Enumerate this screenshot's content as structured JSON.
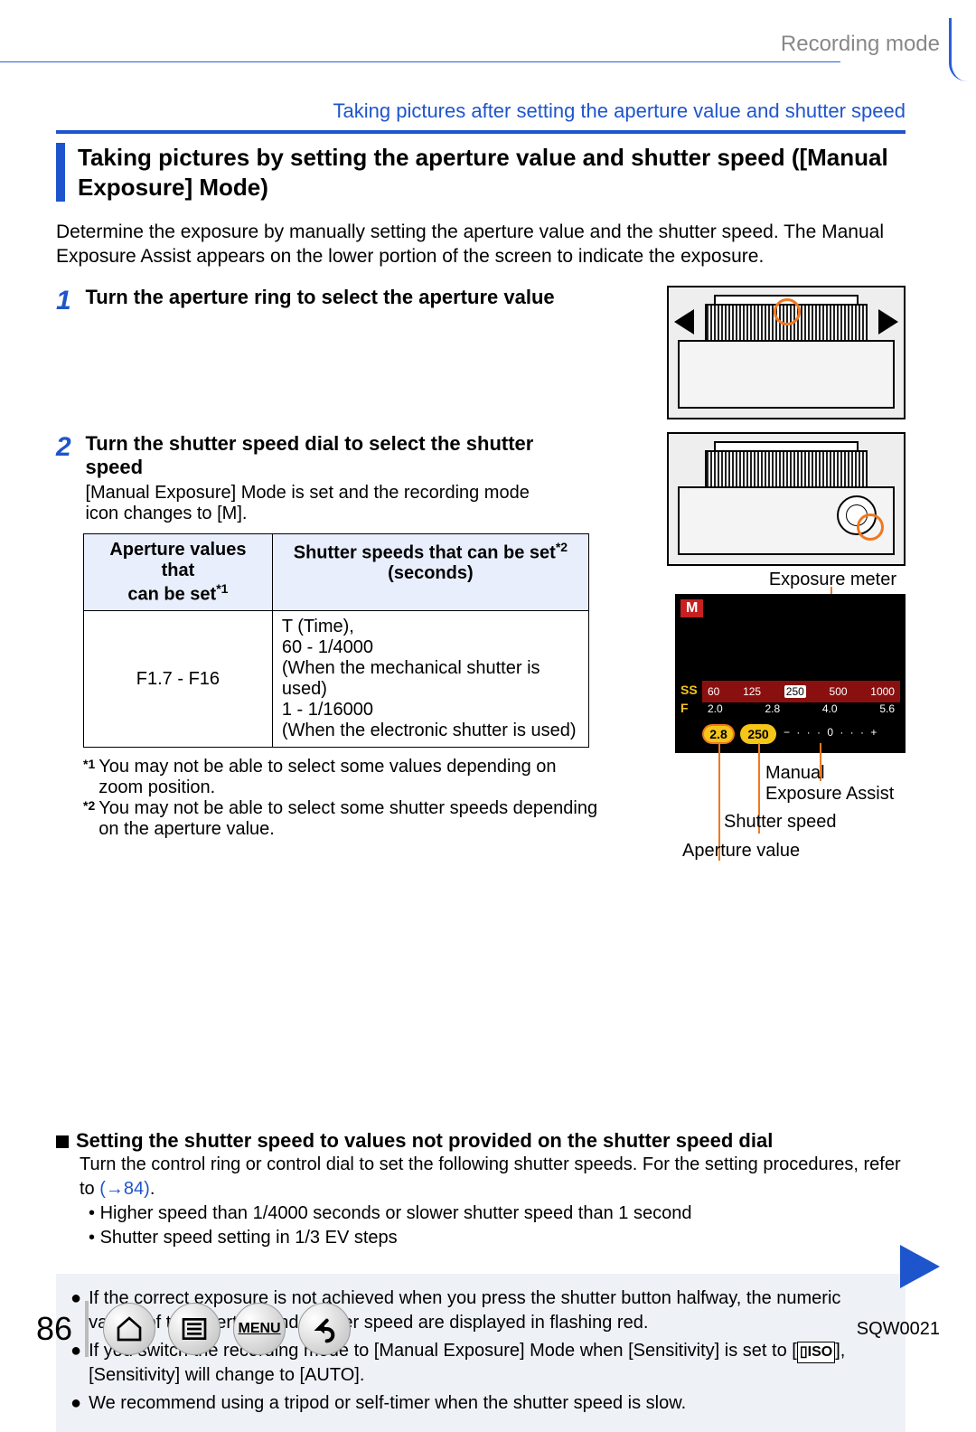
{
  "header": {
    "mode_label": "Recording mode",
    "breadcrumb": "Taking pictures after setting the aperture value and shutter speed"
  },
  "title": "Taking pictures by setting the aperture value and shutter speed ([Manual Exposure] Mode)",
  "intro": "Determine the exposure by manually setting the aperture value and the shutter speed. The Manual Exposure Assist appears on the lower portion of the screen to indicate the exposure.",
  "steps": {
    "s1": {
      "num": "1",
      "title": "Turn the aperture ring to select the aperture value"
    },
    "s2": {
      "num": "2",
      "title": "Turn the shutter speed dial to select the shutter speed",
      "sub": "[Manual Exposure] Mode is set and the recording mode icon changes to [M]."
    }
  },
  "table": {
    "h1a": "Aperture values that",
    "h1b": "can be set",
    "h1sup": "*1",
    "h2a": "Shutter speeds that can be set",
    "h2sup": "*2",
    "h2b": "(seconds)",
    "r1c1": "F1.7 - F16",
    "r1c2_l1": "T (Time),",
    "r1c2_l2": "60 - 1/4000",
    "r1c2_l3": "(When the mechanical shutter is used)",
    "r1c2_l4": "1 - 1/16000",
    "r1c2_l5": "(When the electronic shutter is used)"
  },
  "footnotes": {
    "f1_mark": "*1",
    "f1": "You may not be able to select some values depending on zoom position.",
    "f2_mark": "*2",
    "f2": "You may not be able to select some shutter speeds depending on the aperture value."
  },
  "meter": {
    "top_label": "Exposure meter",
    "m": "M",
    "ss": "SS",
    "f": "F",
    "ss_vals": [
      "60",
      "125",
      "250",
      "500",
      "1000"
    ],
    "f_vals": [
      "2.0",
      "2.8",
      "4.0",
      "5.6"
    ],
    "pill1": "2.8",
    "pill2": "250",
    "ev": "− · · · 0 · · · +",
    "c_manual1": "Manual",
    "c_manual2": "Exposure Assist",
    "c_shutter": "Shutter speed",
    "c_aperture": "Aperture value"
  },
  "subsection": {
    "heading": "Setting the shutter speed to values not provided on the shutter speed dial",
    "body1a": "Turn the control ring or control dial to set the following shutter speeds. For the setting procedures, refer to ",
    "body1_link": "(→84)",
    "body1b": ".",
    "b1": "Higher speed than 1/4000 seconds or slower shutter speed than 1 second",
    "b2": "Shutter speed setting in 1/3 EV steps"
  },
  "notes": {
    "n1": "If the correct exposure is not achieved when you press the shutter button halfway, the numeric values of the aperture and shutter speed are displayed in flashing red.",
    "n2a": "If you switch the recording mode to [Manual Exposure] Mode when [Sensitivity] is set to [",
    "n2_iso": "ISO",
    "n2b": "], [Sensitivity] will change to [AUTO].",
    "n3": "We recommend using a tripod or self-timer when the shutter speed is slow."
  },
  "footer": {
    "page": "86",
    "menu": "MENU",
    "doc": "SQW0021"
  }
}
